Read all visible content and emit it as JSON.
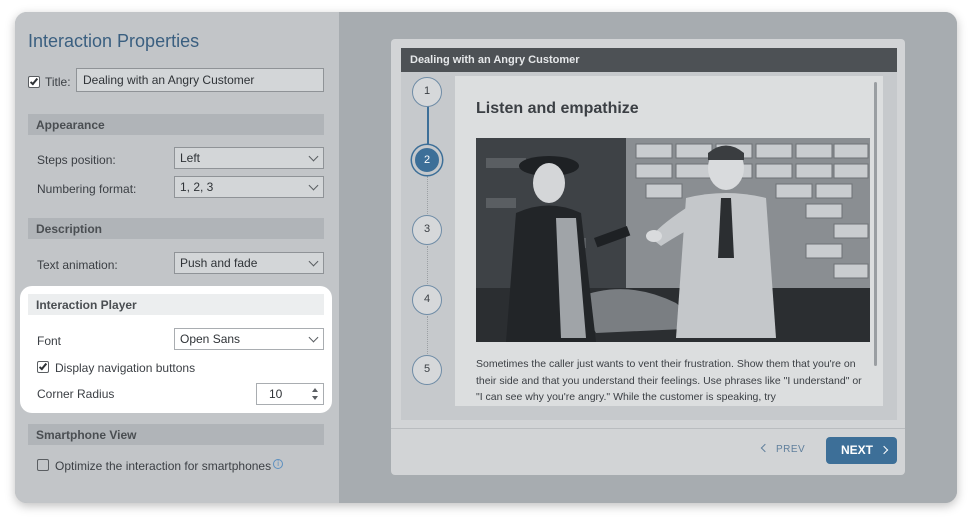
{
  "panel": {
    "title": "Interaction Properties",
    "title_field": {
      "label": "Title:",
      "value": "Dealing with an Angry Customer",
      "checked": true
    }
  },
  "appearance": {
    "heading": "Appearance",
    "steps_position": {
      "label": "Steps position:",
      "value": "Left"
    },
    "numbering_format": {
      "label": "Numbering format:",
      "value": "1, 2, 3"
    }
  },
  "description": {
    "heading": "Description",
    "text_animation": {
      "label": "Text animation:",
      "value": "Push and fade"
    }
  },
  "interaction_player": {
    "heading": "Interaction Player",
    "font": {
      "label": "Font",
      "value": "Open Sans"
    },
    "display_nav": {
      "label": "Display navigation buttons",
      "checked": true
    },
    "corner_radius": {
      "label": "Corner Radius",
      "value": "10"
    }
  },
  "smartphone": {
    "heading": "Smartphone View",
    "optimize": {
      "label": "Optimize the interaction for smartphones",
      "checked": false
    }
  },
  "preview": {
    "header": "Dealing with an Angry Customer",
    "steps": [
      "1",
      "2",
      "3",
      "4",
      "5"
    ],
    "active_step": "2",
    "card_title": "Listen and empathize",
    "card_text": "Sometimes the caller just wants to vent their frustration. Show them that you're on their side and that you understand their feelings. Use phrases like \"I understand\" or \"I can see why you're angry.\" While the customer is speaking, try",
    "prev_label": "PREV",
    "next_label": "NEXT"
  },
  "colors": {
    "accent": "#3d6f98",
    "panel_bg": "#c2c5c8",
    "preview_bg": "#a7acb0"
  }
}
